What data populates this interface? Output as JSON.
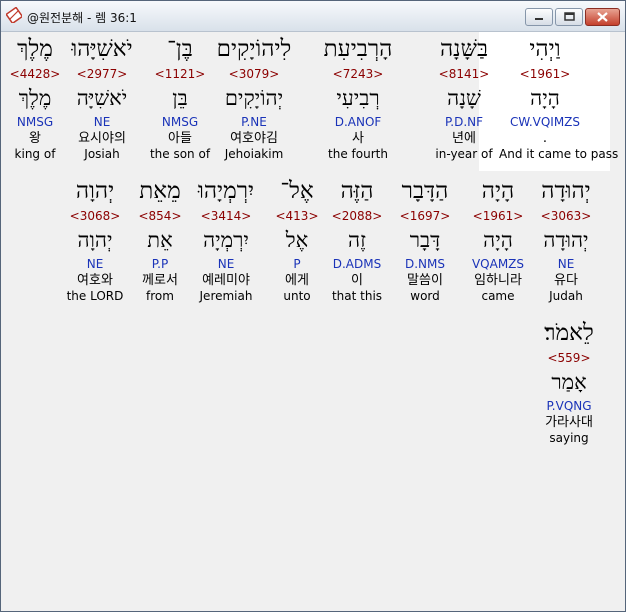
{
  "window": {
    "title": "@원전분해 - 렘 36:1",
    "icon": "bible-app-icon",
    "buttons": [
      "minimize-icon",
      "maximize-icon",
      "close-icon"
    ]
  },
  "colors": {
    "strong": "#8b0000",
    "parsing": "#1a33b8",
    "highlight": "#ffffff"
  },
  "verse": {
    "highlighted_index": 0,
    "words": [
      {
        "hebrew": "וַיְהִי",
        "strong": "<1961>",
        "lemma": "הָיָה",
        "parsing": "CW.VQIMZS",
        "korean": ".",
        "english": "And it came to pass"
      },
      {
        "hebrew": "בַּשָּׁנָה",
        "strong": "<8141>",
        "lemma": "שָׁנָה",
        "parsing": "P.D.NF",
        "korean": "년에",
        "english": "in-year of"
      },
      {
        "hebrew": "הָרְבִיעִת",
        "strong": "<7243>",
        "lemma": "רְבִיעִי",
        "parsing": "D.ANOF",
        "korean": "사",
        "english": "the fourth"
      },
      {
        "hebrew": "לִיהוֹיָקִים",
        "strong": "<3079>",
        "lemma": "יְהוֹיָקִים",
        "parsing": "P.NE",
        "korean": "여호야김",
        "english": "Jehoiakim"
      },
      {
        "hebrew": "בֶּן־",
        "strong": "<1121>",
        "lemma": "בֵּן",
        "parsing": "NMSG",
        "korean": "아들",
        "english": "the son of"
      },
      {
        "hebrew": "יֹאשִׁיָּהוּ",
        "strong": "<2977>",
        "lemma": "יֹאשִׁיָּה",
        "parsing": "NE",
        "korean": "요시야의",
        "english": "Josiah"
      },
      {
        "hebrew": "מֶלֶךְ",
        "strong": "<4428>",
        "lemma": "מֶלֶךְ",
        "parsing": "NMSG",
        "korean": "왕",
        "english": "king of"
      },
      {
        "hebrew": "יְהוּדָה",
        "strong": "<3063>",
        "lemma": "יְהוּדָה",
        "parsing": "NE",
        "korean": "유다",
        "english": "Judah"
      },
      {
        "hebrew": "הָיָה",
        "strong": "<1961>",
        "lemma": "הָיָה",
        "parsing": "VQAMZS",
        "korean": "임하니라",
        "english": "came"
      },
      {
        "hebrew": "הַדָּבָר",
        "strong": "<1697>",
        "lemma": "דָּבָר",
        "parsing": "D.NMS",
        "korean": "말씀이",
        "english": "word"
      },
      {
        "hebrew": "הַזֶּה",
        "strong": "<2088>",
        "lemma": "זֶה",
        "parsing": "D.ADMS",
        "korean": "이",
        "english": "that this"
      },
      {
        "hebrew": "אֶל־",
        "strong": "<413>",
        "lemma": "אֶל",
        "parsing": "P",
        "korean": "에게",
        "english": "unto"
      },
      {
        "hebrew": "יִרְמְיָהוּ",
        "strong": "<3414>",
        "lemma": "יִרְמְיָה",
        "parsing": "NE",
        "korean": "예레미야",
        "english": "Jeremiah"
      },
      {
        "hebrew": "מֵאֵת",
        "strong": "<854>",
        "lemma": "אֵת",
        "parsing": "P.P",
        "korean": "께로서",
        "english": "from"
      },
      {
        "hebrew": "יְהוָה",
        "strong": "<3068>",
        "lemma": "יְהוָה",
        "parsing": "NE",
        "korean": "여호와",
        "english": "the LORD"
      },
      {
        "hebrew": "לֵאמֹר׃",
        "strong": "<559>",
        "lemma": "אָמַר",
        "parsing": "P.VQNG",
        "korean": "가라사대",
        "english": "saying"
      }
    ]
  }
}
